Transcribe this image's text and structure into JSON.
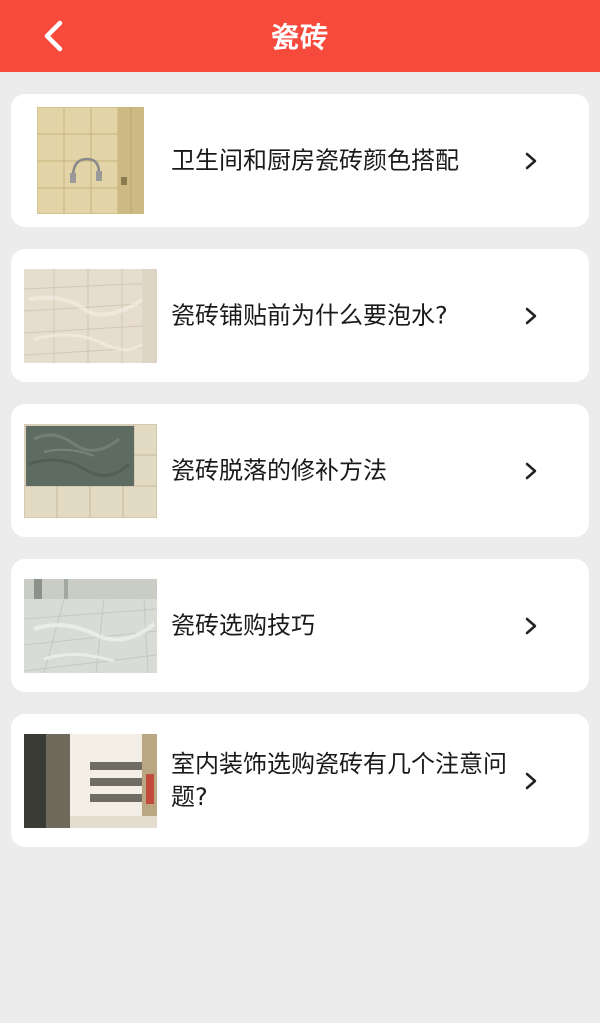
{
  "header": {
    "title": "瓷砖",
    "back_icon": "chevron-left-icon",
    "background": "#f64a3d"
  },
  "articles": [
    {
      "title": "卫生间和厨房瓷砖颜色搭配",
      "thumbnail": "beige wall tiles with shower fixture"
    },
    {
      "title": "瓷砖铺贴前为什么要泡水?",
      "thumbnail": "light marble wall tiles"
    },
    {
      "title": "瓷砖脱落的修补方法",
      "thumbnail": "wall with missing tiles and exposed cement"
    },
    {
      "title": "瓷砖选购技巧",
      "thumbnail": "glossy floor tiles"
    },
    {
      "title": "室内装饰选购瓷砖有几个注意问题?",
      "thumbnail": "bathroom wall with dark tile strips"
    }
  ]
}
